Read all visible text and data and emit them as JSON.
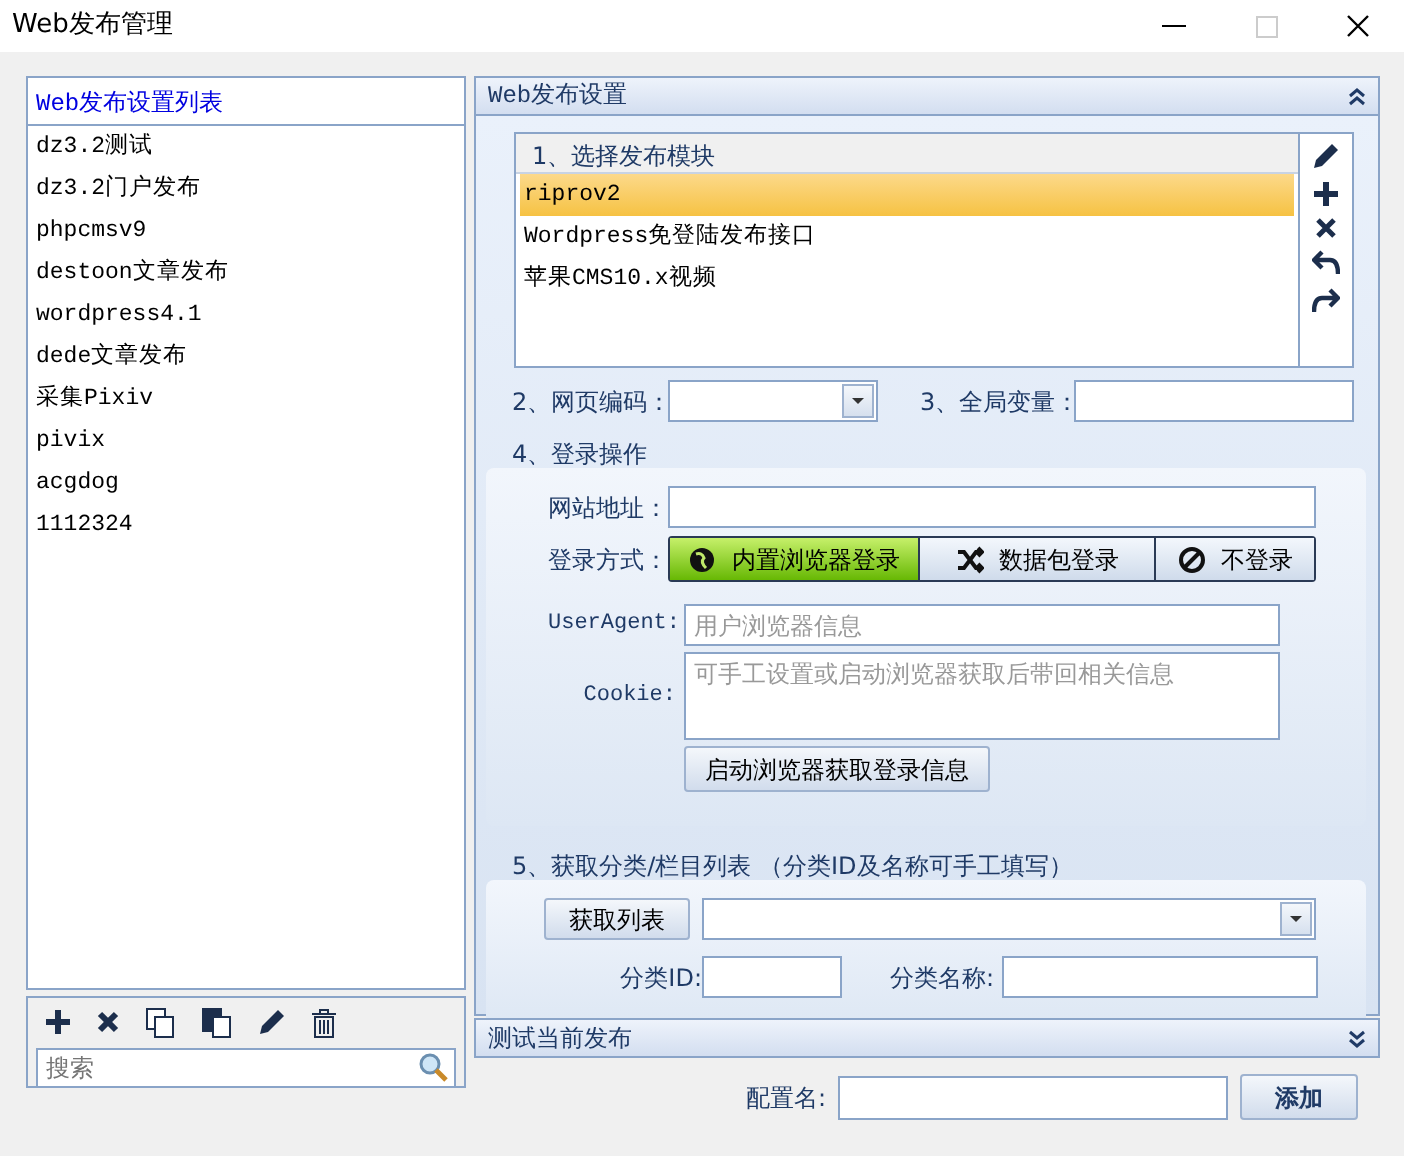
{
  "window": {
    "title": "Web发布管理"
  },
  "sidebar": {
    "title": "Web发布设置列表",
    "items": [
      {
        "label": "dz3.2测试",
        "selected": false
      },
      {
        "label": "dz3.2门户发布",
        "selected": false
      },
      {
        "label": "phpcmsv9",
        "selected": false
      },
      {
        "label": "destoon文章发布",
        "selected": false
      },
      {
        "label": "wordpress4.1",
        "selected": false
      },
      {
        "label": "dede文章发布",
        "selected": false
      },
      {
        "label": "采集Pixiv",
        "selected": false
      },
      {
        "label": "pivix",
        "selected": false
      },
      {
        "label": "acgdog",
        "selected": false
      },
      {
        "label": "1112324",
        "selected": false
      }
    ],
    "search": {
      "placeholder": "搜索"
    }
  },
  "settings": {
    "title": "Web发布设置",
    "modules": {
      "heading": "1、选择发布模块",
      "items": [
        {
          "label": "riprov2",
          "selected": true
        },
        {
          "label": "Wordpress免登陆发布接口",
          "selected": false
        },
        {
          "label": "苹果CMS10.x视频",
          "selected": false
        }
      ]
    },
    "encoding": {
      "label": "2、网页编码："
    },
    "globals": {
      "label": "3、全局变量："
    },
    "login": {
      "heading": "4、登录操作",
      "url_label": "网站地址：",
      "method_label": "登录方式：",
      "methods": [
        {
          "kind": "browser",
          "label": "内置浏览器登录",
          "selected": true
        },
        {
          "kind": "packet",
          "label": "数据包登录",
          "selected": false
        },
        {
          "kind": "none",
          "label": "不登录",
          "selected": false
        }
      ],
      "useragent": {
        "label": "UserAgent:",
        "placeholder": "用户浏览器信息"
      },
      "cookie": {
        "label": "Cookie:",
        "placeholder": "可手工设置或启动浏览器获取后带回相关信息"
      },
      "launch_button": "启动浏览器获取登录信息"
    },
    "category": {
      "heading": "5、获取分类/栏目列表 （分类ID及名称可手工填写）",
      "fetch_button": "获取列表",
      "id_label": "分类ID:",
      "name_label": "分类名称:"
    }
  },
  "test_section": {
    "title": "测试当前发布"
  },
  "footer": {
    "name_label": "配置名:",
    "add_button": "添加"
  }
}
